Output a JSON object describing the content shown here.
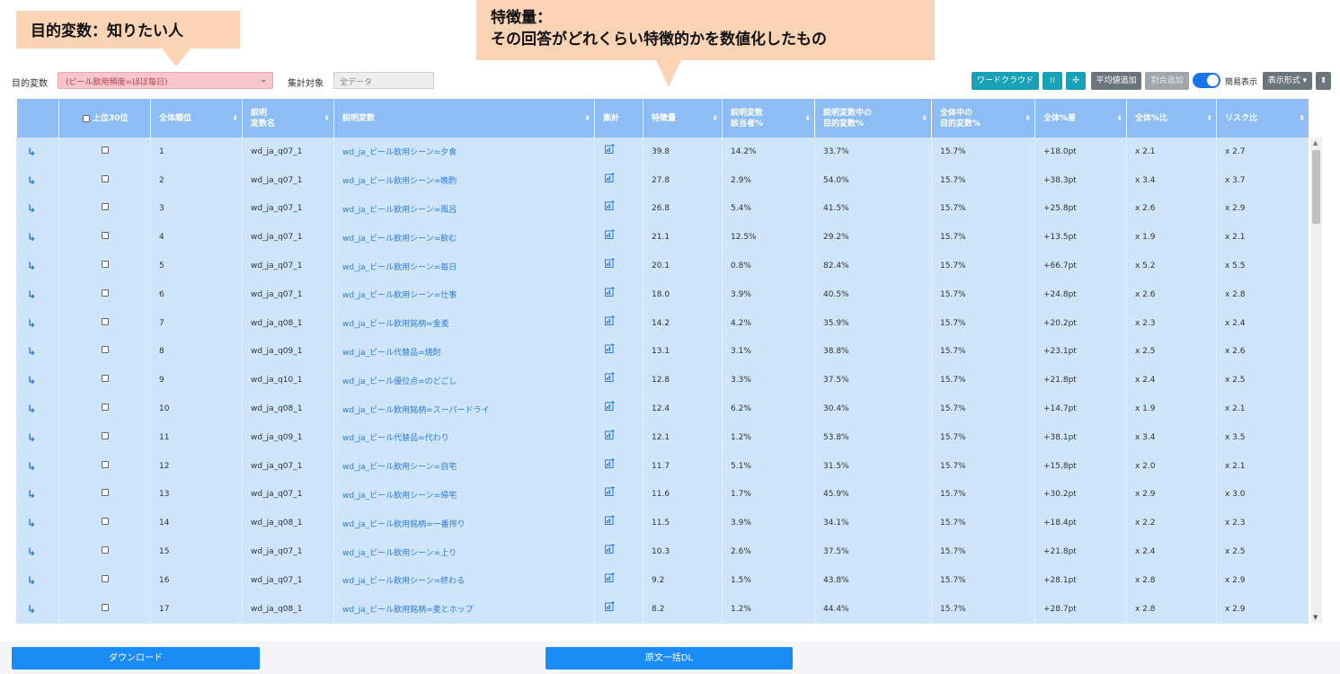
{
  "callouts": {
    "target": "目的変数：知りたい人",
    "feature_line1": "特徴量：",
    "feature_line2": "その回答がどれくらい特徴的かを数値化したもの"
  },
  "controls": {
    "target_label": "目的変数",
    "target_value": "(ビール飲用頻度=ほぼ毎日)",
    "agg_label": "集計対象",
    "agg_value": "全データ",
    "wordcloud": "ワードクラウド",
    "avg_add": "平均値追加",
    "ratio_add": "割合追加",
    "simple_view": "簡易表示",
    "format": "表示形式 ▾"
  },
  "icons": {
    "expand": "↳",
    "chart": "📊",
    "scatter": "⁞⁞",
    "network": "✣"
  },
  "table": {
    "headers": [
      "",
      "上位30位",
      "全体順位",
      "説明\n変数名",
      "説明変数",
      "集計",
      "特徴量",
      "説明変数\n該当者%",
      "説明変数中の\n目的変数%",
      "全体中の\n目的変数%",
      "全体%差",
      "全体%比",
      "リスク比"
    ],
    "rows": [
      [
        "1",
        "wd_ja_q07_1",
        "wd_ja_ビール飲用シーン=夕食",
        "39.8",
        "14.2%",
        "33.7%",
        "15.7%",
        "+18.0pt",
        "x 2.1",
        "x 2.7"
      ],
      [
        "2",
        "wd_ja_q07_1",
        "wd_ja_ビール飲用シーン=晩酌",
        "27.8",
        "2.9%",
        "54.0%",
        "15.7%",
        "+38.3pt",
        "x 3.4",
        "x 3.7"
      ],
      [
        "3",
        "wd_ja_q07_1",
        "wd_ja_ビール飲用シーン=風呂",
        "26.8",
        "5.4%",
        "41.5%",
        "15.7%",
        "+25.8pt",
        "x 2.6",
        "x 2.9"
      ],
      [
        "4",
        "wd_ja_q07_1",
        "wd_ja_ビール飲用シーン=飲む",
        "21.1",
        "12.5%",
        "29.2%",
        "15.7%",
        "+13.5pt",
        "x 1.9",
        "x 2.1"
      ],
      [
        "5",
        "wd_ja_q07_1",
        "wd_ja_ビール飲用シーン=毎日",
        "20.1",
        "0.8%",
        "82.4%",
        "15.7%",
        "+66.7pt",
        "x 5.2",
        "x 5.5"
      ],
      [
        "6",
        "wd_ja_q07_1",
        "wd_ja_ビール飲用シーン=仕事",
        "18.0",
        "3.9%",
        "40.5%",
        "15.7%",
        "+24.8pt",
        "x 2.6",
        "x 2.8"
      ],
      [
        "7",
        "wd_ja_q08_1",
        "wd_ja_ビール飲用銘柄=金麦",
        "14.2",
        "4.2%",
        "35.9%",
        "15.7%",
        "+20.2pt",
        "x 2.3",
        "x 2.4"
      ],
      [
        "8",
        "wd_ja_q09_1",
        "wd_ja_ビール代替品=焼酎",
        "13.1",
        "3.1%",
        "38.8%",
        "15.7%",
        "+23.1pt",
        "x 2.5",
        "x 2.6"
      ],
      [
        "9",
        "wd_ja_q10_1",
        "wd_ja_ビール優位点=のどごし",
        "12.8",
        "3.3%",
        "37.5%",
        "15.7%",
        "+21.8pt",
        "x 2.4",
        "x 2.5"
      ],
      [
        "10",
        "wd_ja_q08_1",
        "wd_ja_ビール飲用銘柄=スーパードライ",
        "12.4",
        "6.2%",
        "30.4%",
        "15.7%",
        "+14.7pt",
        "x 1.9",
        "x 2.1"
      ],
      [
        "11",
        "wd_ja_q09_1",
        "wd_ja_ビール代替品=代わり",
        "12.1",
        "1.2%",
        "53.8%",
        "15.7%",
        "+38.1pt",
        "x 3.4",
        "x 3.5"
      ],
      [
        "12",
        "wd_ja_q07_1",
        "wd_ja_ビール飲用シーン=自宅",
        "11.7",
        "5.1%",
        "31.5%",
        "15.7%",
        "+15.8pt",
        "x 2.0",
        "x 2.1"
      ],
      [
        "13",
        "wd_ja_q07_1",
        "wd_ja_ビール飲用シーン=帰宅",
        "11.6",
        "1.7%",
        "45.9%",
        "15.7%",
        "+30.2pt",
        "x 2.9",
        "x 3.0"
      ],
      [
        "14",
        "wd_ja_q08_1",
        "wd_ja_ビール飲用銘柄=一番搾り",
        "11.5",
        "3.9%",
        "34.1%",
        "15.7%",
        "+18.4pt",
        "x 2.2",
        "x 2.3"
      ],
      [
        "15",
        "wd_ja_q07_1",
        "wd_ja_ビール飲用シーン=上り",
        "10.3",
        "2.6%",
        "37.5%",
        "15.7%",
        "+21.8pt",
        "x 2.4",
        "x 2.5"
      ],
      [
        "16",
        "wd_ja_q07_1",
        "wd_ja_ビール飲用シーン=終わる",
        "9.2",
        "1.5%",
        "43.8%",
        "15.7%",
        "+28.1pt",
        "x 2.8",
        "x 2.9"
      ],
      [
        "17",
        "wd_ja_q08_1",
        "wd_ja_ビール飲用銘柄=麦とホップ",
        "8.2",
        "1.2%",
        "44.4%",
        "15.7%",
        "+28.7pt",
        "x 2.8",
        "x 2.9"
      ]
    ]
  },
  "footer": {
    "download": "ダウンロード",
    "bulk_dl": "原文一括DL"
  }
}
